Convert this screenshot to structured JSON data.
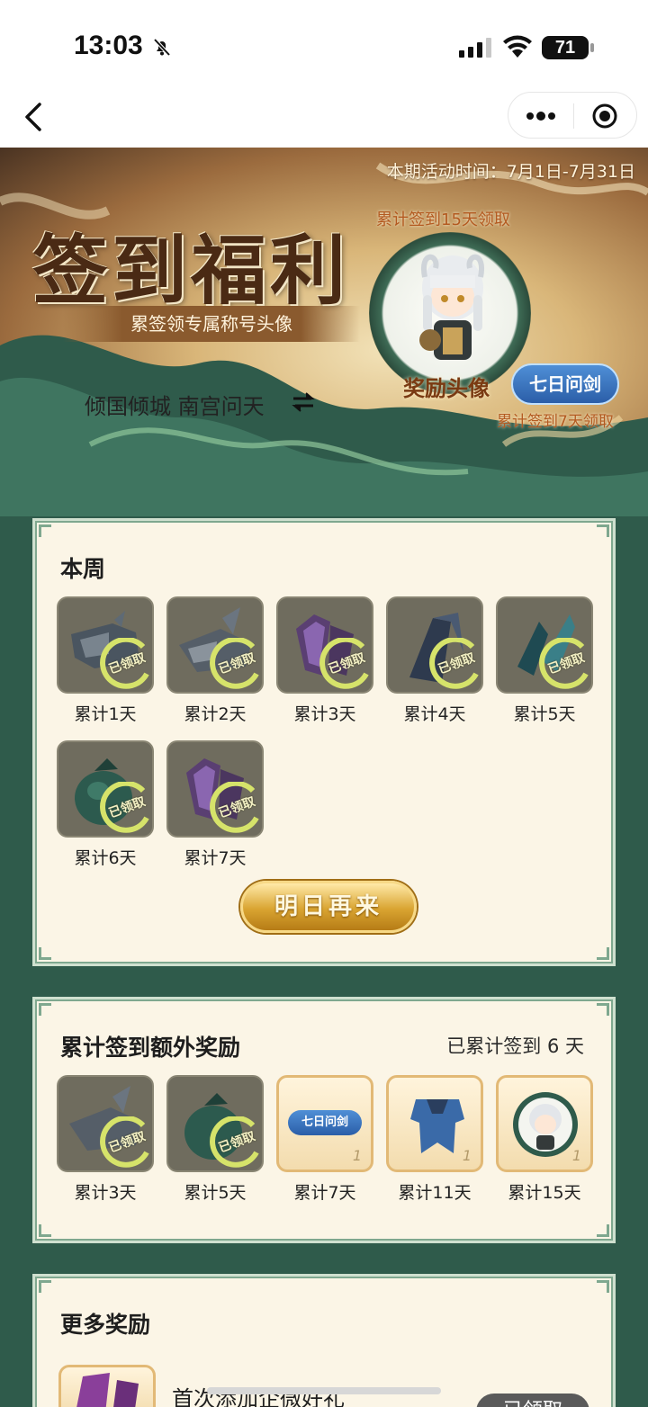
{
  "status_bar": {
    "time": "13:03",
    "battery": "71"
  },
  "nav": {
    "back": "back",
    "more": "more",
    "close": "close"
  },
  "banner": {
    "period": "本期活动时间：7月1日-7月31日",
    "title": "签到福利",
    "subtitle": "累签领专属称号头像",
    "user_name": "倾国倾城 南宫问天",
    "avatar_requirement": "累计签到15天领取",
    "avatar_caption": "奖励头像",
    "badge_text": "七日问剑",
    "badge_requirement": "累计签到7天领取"
  },
  "weekly": {
    "title": "本周",
    "claimed_label": "已领取",
    "items": [
      {
        "label": "累计1天"
      },
      {
        "label": "累计2天"
      },
      {
        "label": "累计3天"
      },
      {
        "label": "累计4天"
      },
      {
        "label": "累计5天"
      },
      {
        "label": "累计6天"
      },
      {
        "label": "累计7天"
      }
    ],
    "cta": "明日再来"
  },
  "cumulative": {
    "title": "累计签到额外奖励",
    "progress": "已累计签到 6 天",
    "items": [
      {
        "label": "累计3天",
        "claimed": true
      },
      {
        "label": "累计5天",
        "claimed": true
      },
      {
        "label": "累计7天",
        "claimed": false,
        "badge": "七日问剑",
        "qty": "1"
      },
      {
        "label": "累计11天",
        "claimed": false,
        "qty": "1"
      },
      {
        "label": "累计15天",
        "claimed": false,
        "qty": "1"
      }
    ]
  },
  "more": {
    "title": "更多奖励",
    "item_title": "首次添加企微好礼",
    "item_button": "已领取"
  },
  "colors": {
    "card_bg": "#fbf5e6",
    "border_green": "#7fa88f",
    "gold": "#d9a431",
    "badge_blue": "#2b5ea8",
    "page_bg": "#2f5b4b"
  }
}
